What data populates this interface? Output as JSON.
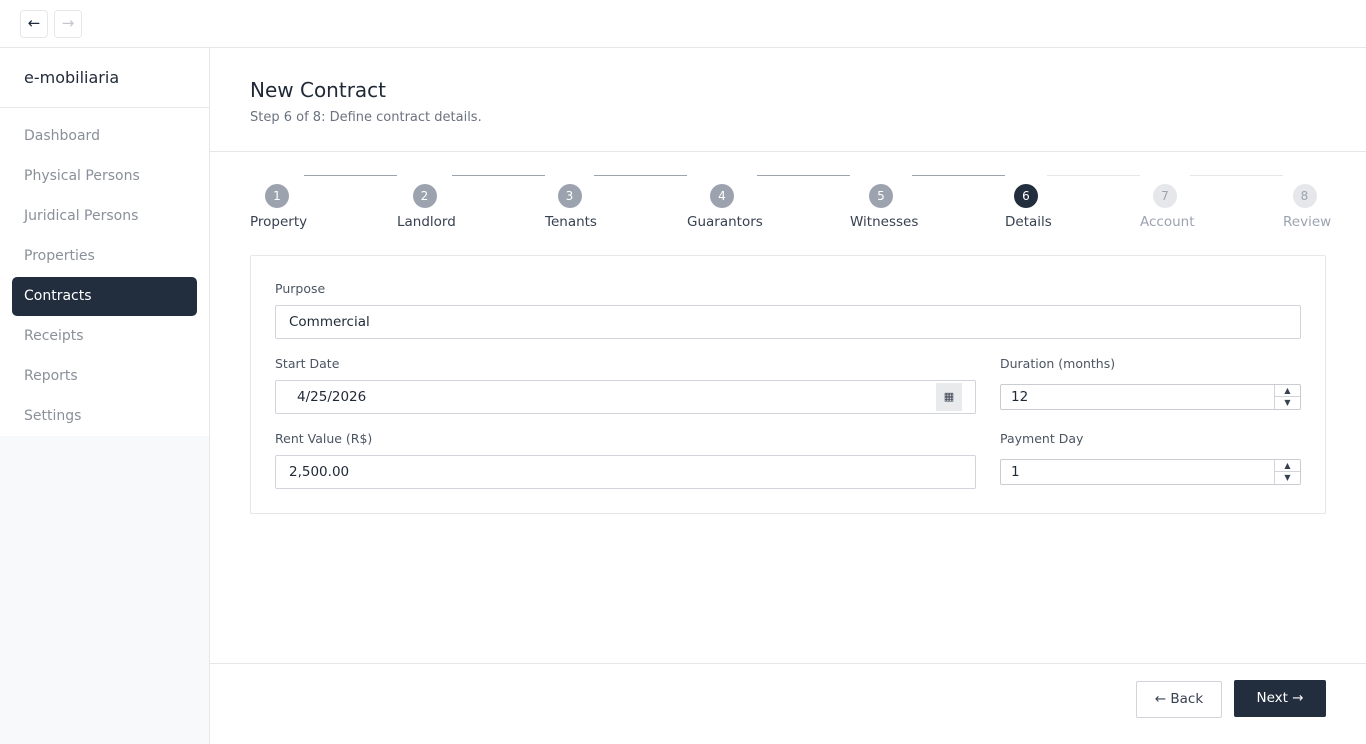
{
  "topbar": {
    "back_icon": "←",
    "forward_icon": "→"
  },
  "sidebar": {
    "brand": "e-mobiliaria",
    "items": [
      {
        "label": "Dashboard",
        "active": false
      },
      {
        "label": "Physical Persons",
        "active": false
      },
      {
        "label": "Juridical Persons",
        "active": false
      },
      {
        "label": "Properties",
        "active": false
      },
      {
        "label": "Contracts",
        "active": true
      },
      {
        "label": "Receipts",
        "active": false
      },
      {
        "label": "Reports",
        "active": false
      },
      {
        "label": "Settings",
        "active": false
      }
    ]
  },
  "page": {
    "title": "New Contract",
    "subtitle": "Step 6 of 8: Define contract details."
  },
  "stepper": {
    "current": 6,
    "steps": [
      {
        "number": "1",
        "label": "Property"
      },
      {
        "number": "2",
        "label": "Landlord"
      },
      {
        "number": "3",
        "label": "Tenants"
      },
      {
        "number": "4",
        "label": "Guarantors"
      },
      {
        "number": "5",
        "label": "Witnesses"
      },
      {
        "number": "6",
        "label": "Details"
      },
      {
        "number": "7",
        "label": "Account"
      },
      {
        "number": "8",
        "label": "Review"
      }
    ]
  },
  "form": {
    "purpose": {
      "label": "Purpose",
      "value": "Commercial"
    },
    "start_date": {
      "label": "Start Date",
      "value": "4/25/2026",
      "icon": "calendar-icon"
    },
    "duration": {
      "label": "Duration (months)",
      "value": "12"
    },
    "rent_value": {
      "label": "Rent Value (R$)",
      "value": "2,500.00"
    },
    "payment_day": {
      "label": "Payment Day",
      "value": "1"
    }
  },
  "footer": {
    "back_label": "← Back",
    "next_label": "Next →"
  },
  "colors": {
    "primary": "#222d3d",
    "step_done": "#9ca3af",
    "step_todo": "#e5e7eb",
    "muted_text": "#8a9099"
  }
}
